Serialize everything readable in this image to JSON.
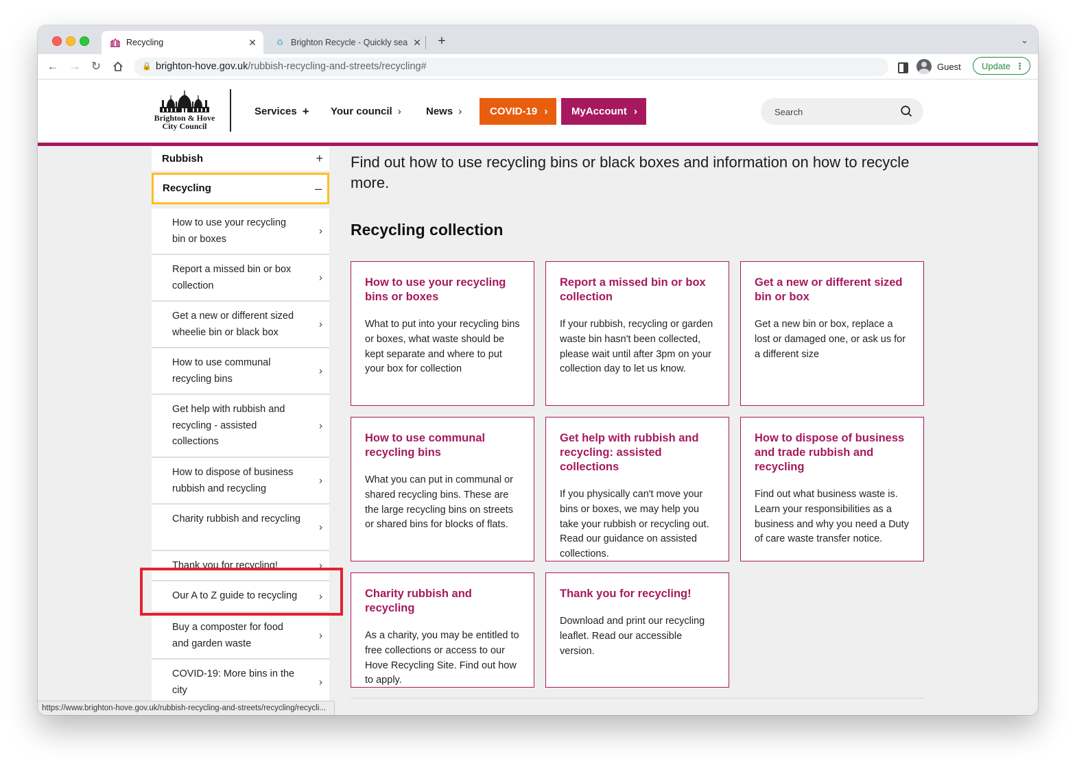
{
  "browser": {
    "tabs": [
      {
        "title": "Recycling",
        "active": true,
        "favicon": "council-logo-icon"
      },
      {
        "title": "Brighton Recycle - Quickly sea",
        "active": false,
        "favicon": "recycle-icon"
      }
    ],
    "url_host": "brighton-hove.gov.uk",
    "url_path": "/rubbish-recycling-and-streets/recycling#",
    "profile_label": "Guest",
    "update_label": "Update",
    "status_url": "https://www.brighton-hove.gov.uk/rubbish-recycling-and-streets/recycling/recycli..."
  },
  "header": {
    "logo_line1": "Brighton & Hove",
    "logo_line2": "City Council",
    "nav": {
      "services": "Services",
      "services_icon": "+",
      "council": "Your council",
      "news": "News",
      "chevron": "›"
    },
    "covid_label": "COVID-19",
    "myaccount_label": "MyAccount",
    "search_placeholder": "Search",
    "accent_color": "#a6195e",
    "covid_color": "#e85e0f"
  },
  "sidebar": {
    "rubbish_label": "Rubbish",
    "rubbish_sign": "+",
    "current_label": "Recycling",
    "current_sign": "–",
    "chevron": "›",
    "items": [
      {
        "label": "How to use your recycling bin or boxes"
      },
      {
        "label": "Report a missed bin or box collection"
      },
      {
        "label": "Get a new or different sized wheelie bin or black box"
      },
      {
        "label": "How to use communal recycling bins"
      },
      {
        "label": "Get help with rubbish and recycling - assisted collections"
      },
      {
        "label": "How to dispose of business rubbish and recycling"
      },
      {
        "label": "Charity rubbish and recycling"
      },
      {
        "label": "Thank you for recycling!"
      },
      {
        "label": "Our A to Z guide to recycling"
      },
      {
        "label": "Buy a composter for food and garden waste"
      },
      {
        "label": "COVID-19: More bins in the city"
      }
    ]
  },
  "main": {
    "intro": "Find out how to use recycling bins or black boxes and information on how to recycle more.",
    "section_title": "Recycling collection",
    "cards": [
      {
        "title": "How to use your recycling bins or boxes",
        "text": "What to put into your recycling bins or boxes, what waste should be kept separate and where to put your box for collection"
      },
      {
        "title": "Report a missed bin or box collection",
        "text": "If your rubbish, recycling or garden waste bin hasn't been collected, please wait until after 3pm on your collection day to let us know."
      },
      {
        "title": "Get a new or different sized bin or box",
        "text": "Get a new bin or box, replace a lost or damaged one, or ask us for a different size"
      },
      {
        "title": "How to use communal recycling bins",
        "text": "What you can put in communal or shared recycling bins. These are the large recycling bins on streets or shared bins for blocks of flats."
      },
      {
        "title": "Get help with rubbish and recycling: assisted collections",
        "text": "If you physically can't move your bins or boxes, we may help you take your rubbish or recycling out. Read our guidance on assisted collections."
      },
      {
        "title": "How to dispose of business and trade rubbish and recycling",
        "text": "Find out what business waste is. Learn your responsibilities as a business and why you need a Duty of care waste transfer notice."
      },
      {
        "title": "Charity rubbish and recycling",
        "text": "As a charity, you may be entitled to free collections or access to our Hove Recycling Site. Find out how to apply."
      },
      {
        "title": "Thank you for recycling!",
        "text": "Download and print our recycling leaflet. Read our accessible version."
      }
    ]
  }
}
